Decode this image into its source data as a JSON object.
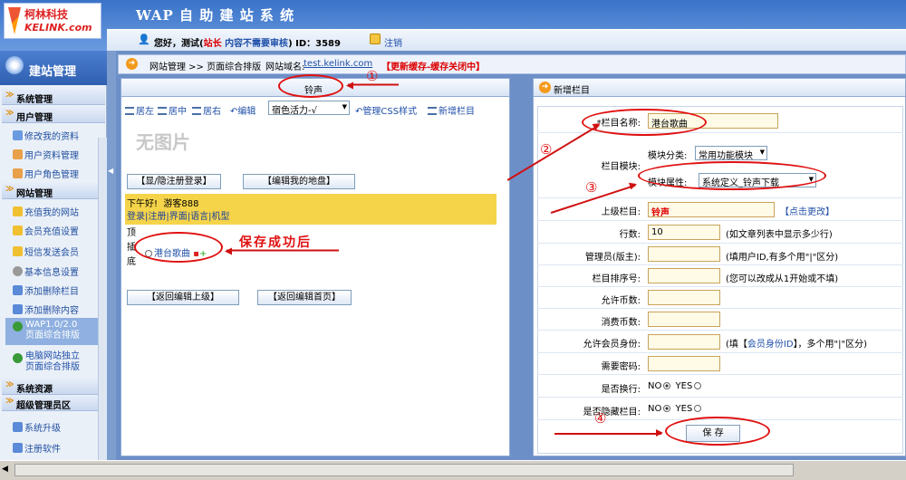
{
  "logo": {
    "cn": "柯林科技",
    "en": "KELINK.com"
  },
  "app": {
    "title": "WAP 自 助 建 站 系 统"
  },
  "userbar": {
    "greeting": "您好，测试(",
    "role": "站长",
    "review": "内容不需要审核",
    "after": ")",
    "id_text": "ID：3589",
    "logout": "注销"
  },
  "sidebar": {
    "header": "建站管理",
    "sections": {
      "system": "系统管理",
      "user": "用户管理",
      "site": "网站管理",
      "resources": "系统资源",
      "super": "超级管理员区"
    },
    "items": {
      "edit_profile": "修改我的资料",
      "user_profile": "用户资料管理",
      "user_role": "用户角色管理",
      "recharge": "充值我的网站",
      "member_recharge": "会员充值设置",
      "sms": "短信发送会员",
      "basic_info": "基本信息设置",
      "add_column": "添加删除栏目",
      "add_content": "添加删除内容",
      "wap_layout": "WAP1.0/2.0\n页面综合排版",
      "pc_layout": "电脑网站独立\n页面综合排版",
      "upgrade": "系统升级",
      "register": "注册软件"
    }
  },
  "crumb": {
    "path": "网站管理 >> 页面综合排版",
    "domain_label": "网站域名:",
    "domain": "test.kelink.com",
    "cache": "【更新缓存-缓存关闭中】"
  },
  "left": {
    "tab": "铃声",
    "toolbar": {
      "left": "居左",
      "center": "居中",
      "right": "居右",
      "edit": "编辑",
      "style": "宿色活力-√",
      "css": "管理CSS样式",
      "add": "新增栏目"
    },
    "noimg": "无图片",
    "btn_login": "【显/隐注册登录】",
    "btn_land": "【编辑我的地盘】",
    "greet_line1": "下午好!  游客888",
    "greet_line2": "登录|注册|界面|语言|机型",
    "side_labels": [
      "顶",
      "插",
      "底"
    ],
    "item": "港台歌曲",
    "save_note": "保存成功后",
    "btn_back_up": "【返回编辑上级】",
    "btn_back_home": "【返回编辑首页】"
  },
  "right": {
    "title": "新增栏目",
    "fields": {
      "name_label": "*栏目名称:",
      "name_value": "港台歌曲",
      "module_label": "栏目模块:",
      "category_label": "模块分类:",
      "category_value": "常用功能模块",
      "attr_label": "模块属性:",
      "attr_value": "系统定义_铃声下载",
      "parent_label": "上级栏目:",
      "parent_value": "铃声",
      "parent_change": "【点击更改】",
      "rows_label": "行数:",
      "rows_value": "10",
      "rows_hint": "(如文章列表中显示多少行)",
      "admin_label": "管理员(版主):",
      "admin_hint": "(填用户ID,有多个用\"|\"区分)",
      "order_label": "栏目排序号:",
      "order_hint": "(您可以改成从1开始或不填)",
      "allow_coin_label": "允许币数:",
      "spend_coin_label": "消费币数:",
      "member_label": "允许会员身份:",
      "member_hint_a": "(填【",
      "member_hint_link": "会员身份ID",
      "member_hint_b": "】，多个用\"|\"区分)",
      "password_label": "需要密码:",
      "newline_label": "是否换行:",
      "hidden_label": "是否隐藏栏目:",
      "no": "NO",
      "yes": "YES",
      "save": "保 存"
    }
  },
  "annotations": {
    "n1": "①",
    "n2": "②",
    "n3": "③",
    "n4": "④"
  },
  "colors": {
    "accent_red": "#e01010",
    "header_blue": "#3a73c8",
    "link_blue": "#1f4fa8",
    "banner_yellow": "#f5d44a"
  }
}
